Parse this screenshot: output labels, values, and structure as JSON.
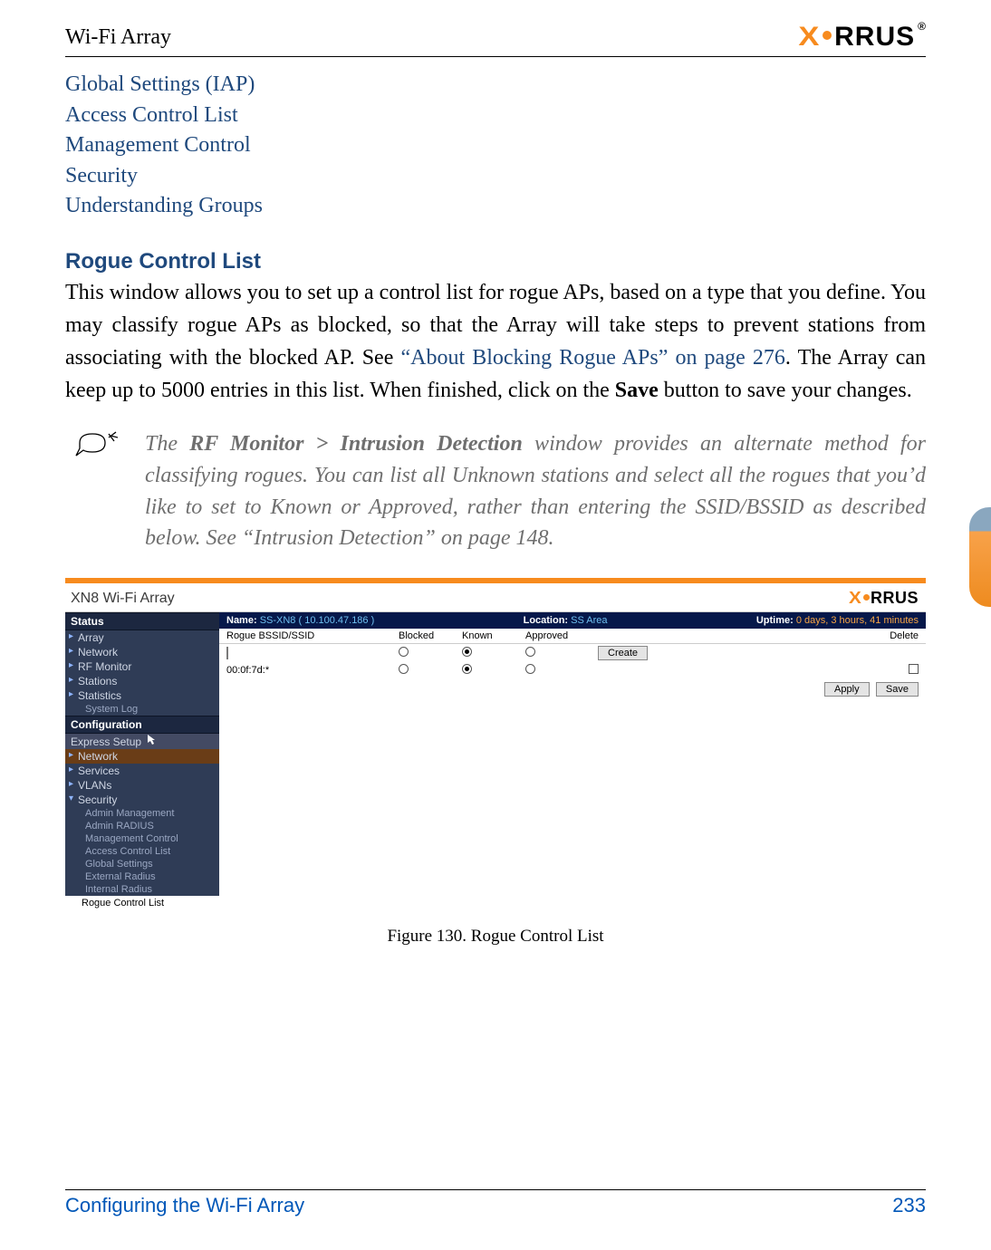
{
  "header": {
    "title": "Wi-Fi Array",
    "brand_x": "X",
    "brand_rest": "RRUS",
    "brand_tm": "®"
  },
  "xrefs": [
    "Global Settings (IAP)",
    "Access Control List",
    "Management Control",
    "Security",
    "Understanding Groups"
  ],
  "section": {
    "heading": "Rogue Control List",
    "para_a": "This window allows you to set up a control list for rogue APs, based on a type that you define. You may classify rogue APs as blocked, so that the Array will take steps to prevent stations from associating with the blocked AP. See ",
    "para_link": "“About Blocking Rogue APs” on page 276",
    "para_b": ". The Array can keep up to 5000 entries in this list. When finished, click on the ",
    "para_bold": "Save",
    "para_c": " button to save your changes."
  },
  "note": {
    "icon": "#",
    "t1": "The ",
    "strong": "RF Monitor > Intrusion Detection",
    "t2": " window provides an alternate method for classifying rogues. You can list all Unknown stations and select all the rogues that you’d like to set to Known or Approved, rather than entering the SSID/BSSID as described below. See “Intrusion Detection” on page 148."
  },
  "figure": {
    "titlebar": "XN8 Wi-Fi Array",
    "nav": {
      "sec_status": "Status",
      "items_status": [
        "Array",
        "Network",
        "RF Monitor",
        "Stations",
        "Statistics"
      ],
      "sub_syslog": "System Log",
      "sec_config": "Configuration",
      "item_express": "Express Setup",
      "cursor": "▸",
      "item_network": "Network",
      "item_services": "Services",
      "item_vlans": "VLANs",
      "item_security": "Security",
      "subs_security": [
        "Admin Management",
        "Admin RADIUS",
        "Management Control",
        "Access Control List",
        "Global Settings",
        "External Radius",
        "Internal Radius"
      ],
      "item_rogue": "Rogue Control List"
    },
    "status": {
      "name_lbl": "Name:",
      "name_val": "SS-XN8   ( 10.100.47.186 )",
      "loc_lbl": "Location:",
      "loc_val": "SS Area",
      "up_lbl": "Uptime:",
      "up_val": "0 days, 3 hours, 41 minutes"
    },
    "grid": {
      "h_bssid": "Rogue BSSID/SSID",
      "h_blocked": "Blocked",
      "h_known": "Known",
      "h_approved": "Approved",
      "h_delete": "Delete",
      "row1_bssid": "",
      "row2_bssid": "00:0f:7d:*",
      "btn_create": "Create",
      "btn_apply": "Apply",
      "btn_save": "Save"
    },
    "caption": "Figure 130. Rogue Control List"
  },
  "footer": {
    "left": "Configuring the Wi-Fi Array",
    "right": "233"
  }
}
